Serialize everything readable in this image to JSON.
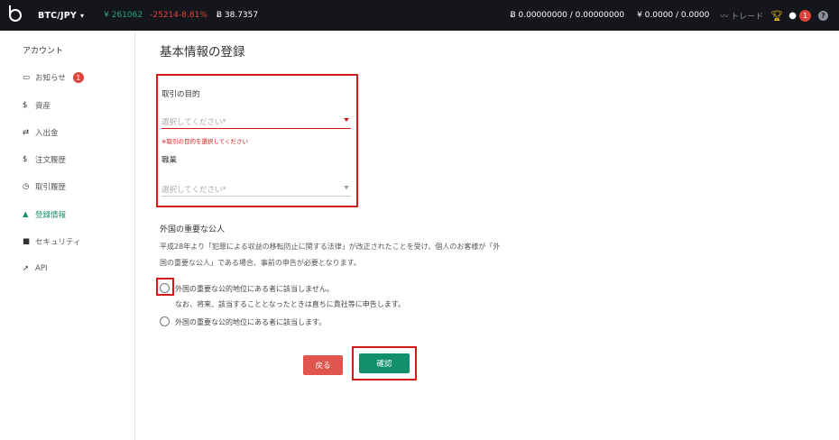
{
  "topbar": {
    "pair": "BTC/JPY",
    "price_jpy": "¥ 261062",
    "price_change": "-25214-8.81%",
    "price_btc": "Ƀ 38.7357",
    "btc_balance": "Ƀ 0.00000000 / 0.00000000",
    "jpy_balance": "¥ 0.0000 / 0.0000",
    "trade_link": "トレード",
    "notification_count": "1"
  },
  "sidebar": {
    "title": "アカウント",
    "items": [
      {
        "icon": "inbox-icon",
        "label": "お知らせ",
        "badge": "1"
      },
      {
        "icon": "dollar-icon",
        "label": "資産"
      },
      {
        "icon": "transfer-icon",
        "label": "入出金"
      },
      {
        "icon": "dollar-icon",
        "label": "注文履歴"
      },
      {
        "icon": "clock-icon",
        "label": "取引履歴"
      },
      {
        "icon": "user-icon",
        "label": "登録情報",
        "active": true
      },
      {
        "icon": "lock-icon",
        "label": "セキュリティ"
      },
      {
        "icon": "send-icon",
        "label": "API"
      }
    ]
  },
  "main": {
    "title": "基本情報の登録",
    "purpose": {
      "label": "取引の目的",
      "placeholder": "選択してください*",
      "error": "※取引の目的を選択してください"
    },
    "occupation": {
      "label": "職業",
      "placeholder": "選択してください*"
    },
    "peps": {
      "title": "外国の重要な公人",
      "paragraph_line1": "平成28年より「犯罪による収益の移転防止に関する法律」が改正されたことを受け、個人のお客様が「外",
      "paragraph_line2": "国の重要な公人」である場合、事前の申告が必要となります。",
      "option1_line1": "外国の重要な公的地位にある者に該当しません。",
      "option1_line2": "なお、将来、該当することとなったときは直ちに貴社等に申告します。",
      "option2": "外国の重要な公的地位にある者に該当します。"
    },
    "buttons": {
      "back": "戻る",
      "confirm": "確認"
    }
  },
  "colors": {
    "accent": "#12906a",
    "error": "#d31a1a",
    "topbar_bg": "#15161c"
  }
}
